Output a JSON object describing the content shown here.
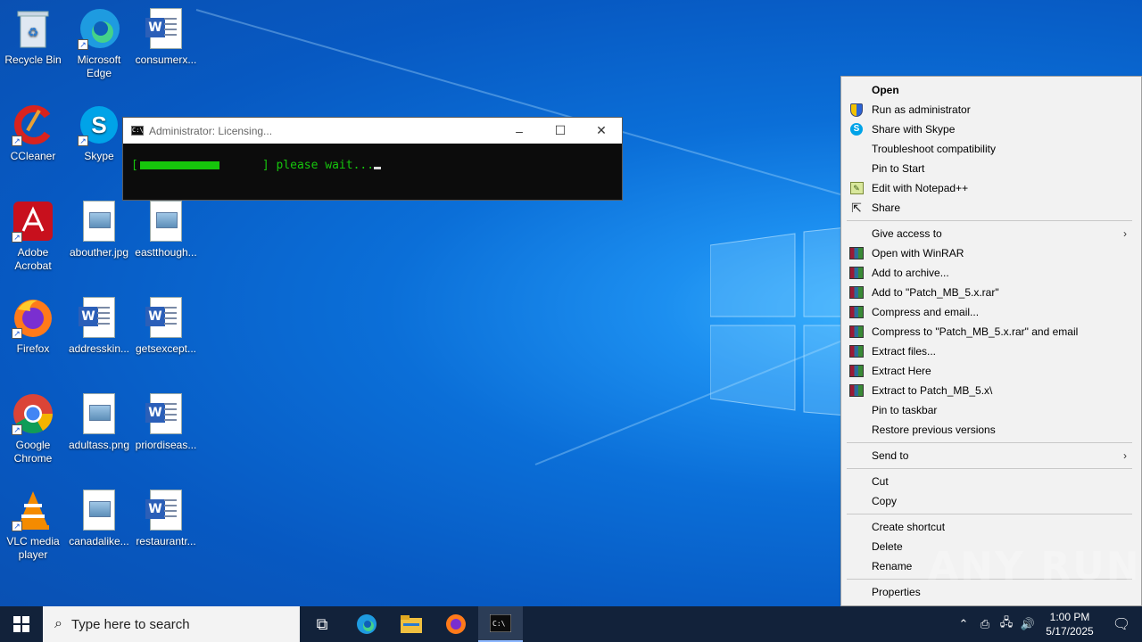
{
  "desktop": {
    "icons": [
      {
        "label": "Recycle Bin"
      },
      {
        "label": "Microsoft Edge"
      },
      {
        "label": "consumerx..."
      },
      {
        "label": "CCleaner"
      },
      {
        "label": "Skype"
      },
      {
        "label": "Adobe Acrobat"
      },
      {
        "label": "abouther.jpg"
      },
      {
        "label": "eastthough..."
      },
      {
        "label": "Firefox"
      },
      {
        "label": "addresskin..."
      },
      {
        "label": "getsexcept..."
      },
      {
        "label": "Google Chrome"
      },
      {
        "label": "adultass.png"
      },
      {
        "label": "priordiseas..."
      },
      {
        "label": "VLC media player"
      },
      {
        "label": "canadalike..."
      },
      {
        "label": "restaurantr..."
      }
    ]
  },
  "cmd_window": {
    "title": "Administrator:  Licensing...",
    "open_bracket": "[",
    "close_text": "] please wait...",
    "progress_fraction": 0.35,
    "icon": "console-icon"
  },
  "context_menu": {
    "items": [
      {
        "label": "Open",
        "icon": ""
      },
      {
        "label": "Run as administrator",
        "icon": "shield-icon"
      },
      {
        "label": "Share with Skype",
        "icon": "skype-icon"
      },
      {
        "label": "Troubleshoot compatibility",
        "icon": ""
      },
      {
        "label": "Pin to Start",
        "icon": ""
      },
      {
        "label": "Edit with Notepad++",
        "icon": "notepad-plus-plus-icon"
      },
      {
        "label": "Share",
        "icon": "share-icon"
      },
      {
        "label": "Give access to",
        "icon": ""
      },
      {
        "label": "Open with WinRAR",
        "icon": "winrar-icon"
      },
      {
        "label": "Add to archive...",
        "icon": "winrar-icon"
      },
      {
        "label": "Add to \"Patch_MB_5.x.rar\"",
        "icon": "winrar-icon"
      },
      {
        "label": "Compress and email...",
        "icon": "winrar-icon"
      },
      {
        "label": "Compress to \"Patch_MB_5.x.rar\" and email",
        "icon": "winrar-icon"
      },
      {
        "label": "Extract files...",
        "icon": "winrar-icon"
      },
      {
        "label": "Extract Here",
        "icon": "winrar-icon"
      },
      {
        "label": "Extract to Patch_MB_5.x\\",
        "icon": "winrar-icon"
      },
      {
        "label": "Pin to taskbar",
        "icon": ""
      },
      {
        "label": "Restore previous versions",
        "icon": ""
      },
      {
        "label": "Send to",
        "icon": ""
      },
      {
        "label": "Cut",
        "icon": ""
      },
      {
        "label": "Copy",
        "icon": ""
      },
      {
        "label": "Create shortcut",
        "icon": ""
      },
      {
        "label": "Delete",
        "icon": ""
      },
      {
        "label": "Rename",
        "icon": ""
      },
      {
        "label": "Properties",
        "icon": ""
      }
    ]
  },
  "taskbar": {
    "search_placeholder": "Type here to search",
    "pinned": [
      "task-view-icon",
      "edge-icon",
      "file-explorer-icon",
      "firefox-icon",
      "cmd-icon"
    ],
    "time": "1:00 PM",
    "date": "5/17/2025"
  },
  "watermark": "ANY RUN",
  "colors": {
    "desktop_blue": "#0b6fd8",
    "console_green": "#16c60c",
    "taskbar": "#12223a",
    "menu_bg": "#f2f2f2"
  }
}
